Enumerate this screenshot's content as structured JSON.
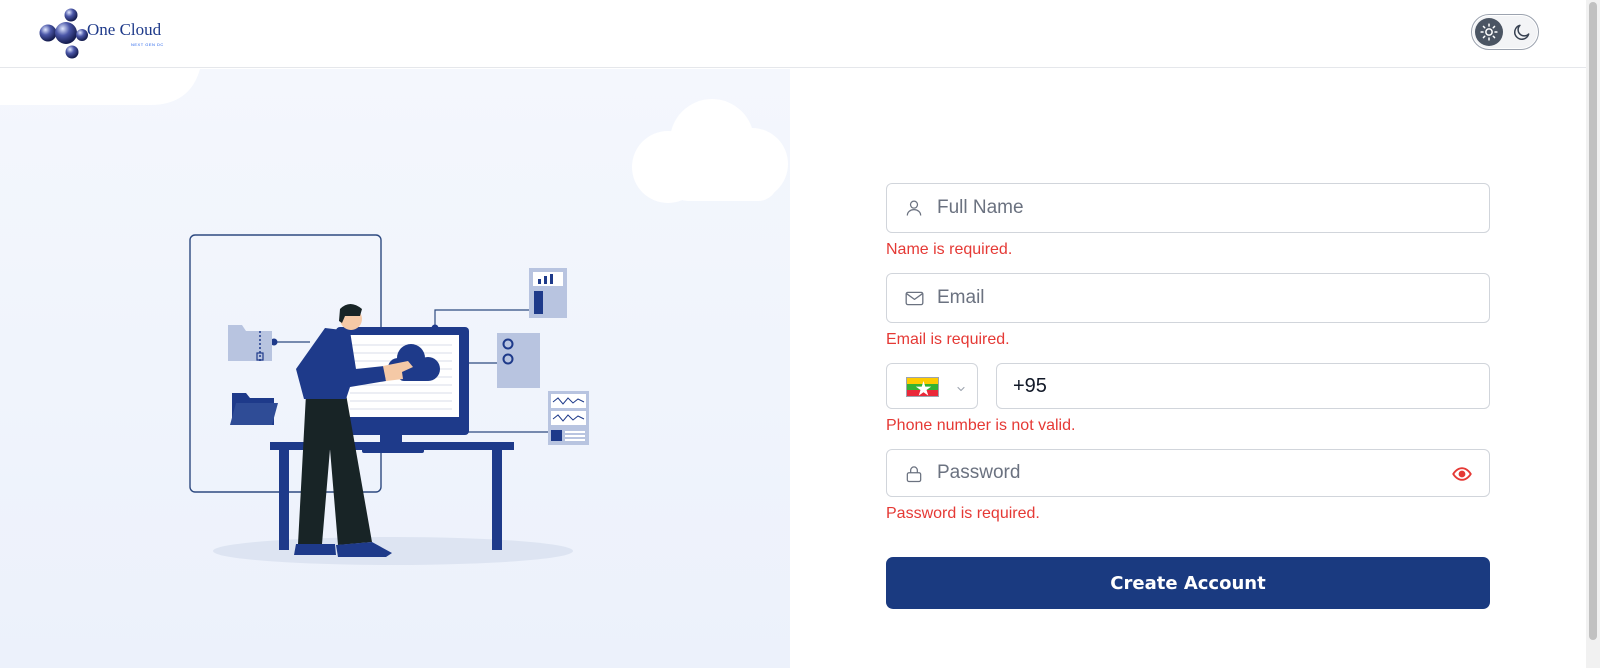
{
  "header": {
    "logo_text": "One Cloud",
    "logo_tagline": "NEXT GEN DC",
    "theme_toggle": {
      "active": "light",
      "options": [
        "sun-icon",
        "moon-icon"
      ]
    }
  },
  "form": {
    "full_name": {
      "placeholder": "Full Name",
      "value": "",
      "icon": "user-icon",
      "error": "Name is required."
    },
    "email": {
      "placeholder": "Email",
      "value": "",
      "icon": "mail-icon",
      "error": "Email is required."
    },
    "phone": {
      "country_flag": "myanmar-flag-icon",
      "dial_code": "+95",
      "error": "Phone number is not valid."
    },
    "password": {
      "placeholder": "Password",
      "value": "",
      "icon": "lock-icon",
      "toggle_icon": "eye-icon",
      "error": "Password is required."
    },
    "submit_label": "Create Account"
  },
  "colors": {
    "primary": "#1a3a80",
    "error": "#e53935",
    "illustration_bg": "#eef2fb",
    "border": "#d1d5db"
  }
}
